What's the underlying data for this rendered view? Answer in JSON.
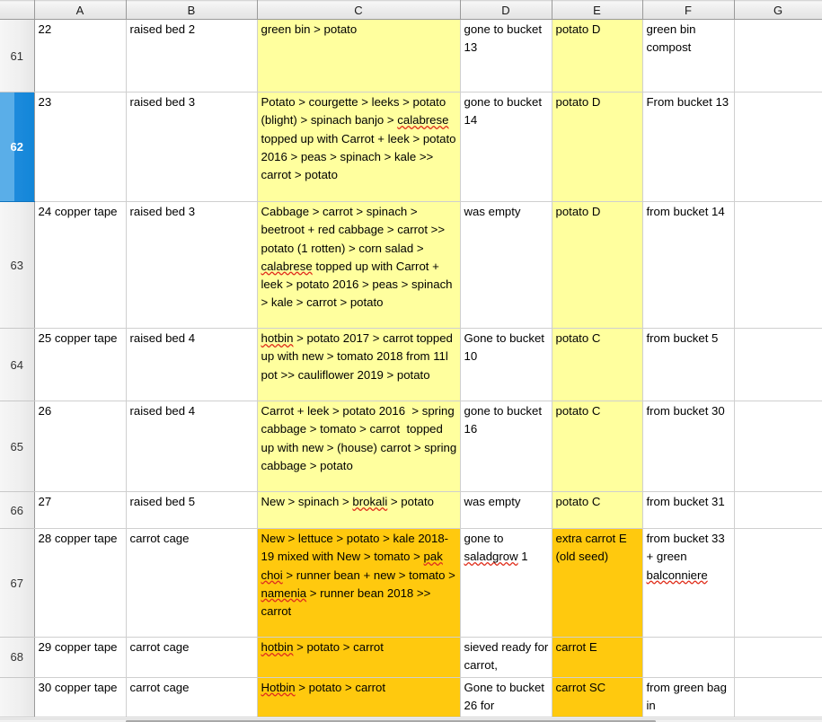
{
  "grid": {
    "column_headers": [
      "A",
      "B",
      "C",
      "D",
      "E",
      "F",
      "G"
    ],
    "corner_label": "",
    "selected_row": "62"
  },
  "rows": [
    {
      "header": "61",
      "selected": false,
      "height": 81,
      "cells": [
        {
          "col": "A",
          "text": "22",
          "fill": "none"
        },
        {
          "col": "B",
          "text": "raised bed 2",
          "fill": "none"
        },
        {
          "col": "C",
          "text": "green bin > potato",
          "fill": "yellow"
        },
        {
          "col": "D",
          "text": "gone to bucket 13",
          "fill": "none"
        },
        {
          "col": "E",
          "text": "potato D",
          "fill": "yellow"
        },
        {
          "col": "F",
          "text": "green bin compost",
          "fill": "none"
        },
        {
          "col": "G",
          "text": "",
          "fill": "none"
        }
      ]
    },
    {
      "header": "62",
      "selected": true,
      "height": 122,
      "cells": [
        {
          "col": "A",
          "text": "23",
          "fill": "none"
        },
        {
          "col": "B",
          "text": "raised bed 3",
          "fill": "none"
        },
        {
          "col": "C",
          "text": "Potato > courgette > leeks > potato (blight) > spinach banjo > calabrese topped up with Carrot + leek > potato 2016 > peas > spinach > kale >> carrot > potato",
          "fill": "yellow",
          "misspelled": [
            "calabrese"
          ]
        },
        {
          "col": "D",
          "text": "gone to bucket 14",
          "fill": "none"
        },
        {
          "col": "E",
          "text": "potato D",
          "fill": "yellow"
        },
        {
          "col": "F",
          "text": "From bucket 13",
          "fill": "none"
        },
        {
          "col": "G",
          "text": "",
          "fill": "none"
        }
      ]
    },
    {
      "header": "63",
      "selected": false,
      "height": 141,
      "cells": [
        {
          "col": "A",
          "text": "24 copper tape",
          "fill": "none"
        },
        {
          "col": "B",
          "text": "raised bed 3",
          "fill": "none"
        },
        {
          "col": "C",
          "text": "Cabbage > carrot > spinach > beetroot + red cabbage > carrot >> potato (1 rotten) > corn salad > calabrese topped up with Carrot + leek > potato 2016 > peas > spinach > kale > carrot > potato",
          "fill": "yellow",
          "misspelled": [
            "calabrese"
          ]
        },
        {
          "col": "D",
          "text": "was empty",
          "fill": "none"
        },
        {
          "col": "E",
          "text": "potato D",
          "fill": "yellow"
        },
        {
          "col": "F",
          "text": "from bucket 14",
          "fill": "none"
        },
        {
          "col": "G",
          "text": "",
          "fill": "none"
        }
      ]
    },
    {
      "header": "64",
      "selected": false,
      "height": 81,
      "cells": [
        {
          "col": "A",
          "text": "25 copper tape",
          "fill": "none"
        },
        {
          "col": "B",
          "text": "raised bed 4",
          "fill": "none"
        },
        {
          "col": "C",
          "text": "hotbin > potato 2017 > carrot topped up with new > tomato 2018 from 11l pot >> cauliflower 2019 > potato",
          "fill": "yellow",
          "misspelled": [
            "hotbin"
          ]
        },
        {
          "col": "D",
          "text": "Gone to bucket 10",
          "fill": "none"
        },
        {
          "col": "E",
          "text": "potato C",
          "fill": "yellow"
        },
        {
          "col": "F",
          "text": "from bucket 5",
          "fill": "none"
        },
        {
          "col": "G",
          "text": "",
          "fill": "none"
        }
      ]
    },
    {
      "header": "65",
      "selected": false,
      "height": 101,
      "cells": [
        {
          "col": "A",
          "text": "26",
          "fill": "none"
        },
        {
          "col": "B",
          "text": "raised bed 4",
          "fill": "none"
        },
        {
          "col": "C",
          "text": "Carrot + leek > potato 2016  > spring cabbage > tomato > carrot  topped up with new > (house) carrot > spring cabbage > potato",
          "fill": "yellow"
        },
        {
          "col": "D",
          "text": "gone to bucket 16",
          "fill": "none"
        },
        {
          "col": "E",
          "text": "potato C",
          "fill": "yellow"
        },
        {
          "col": "F",
          "text": "from bucket 30",
          "fill": "none"
        },
        {
          "col": "G",
          "text": "",
          "fill": "none"
        }
      ]
    },
    {
      "header": "66",
      "selected": false,
      "height": 41,
      "cells": [
        {
          "col": "A",
          "text": "27",
          "fill": "none"
        },
        {
          "col": "B",
          "text": "raised bed 5",
          "fill": "none"
        },
        {
          "col": "C",
          "text": "New > spinach > brokali > potato",
          "fill": "yellow",
          "misspelled": [
            "brokali"
          ]
        },
        {
          "col": "D",
          "text": "was empty",
          "fill": "none"
        },
        {
          "col": "E",
          "text": "potato C",
          "fill": "yellow"
        },
        {
          "col": "F",
          "text": "from bucket 31",
          "fill": "none"
        },
        {
          "col": "G",
          "text": "",
          "fill": "none"
        }
      ]
    },
    {
      "header": "67",
      "selected": false,
      "height": 121,
      "cells": [
        {
          "col": "A",
          "text": "28 copper tape",
          "fill": "none"
        },
        {
          "col": "B",
          "text": "carrot cage",
          "fill": "none"
        },
        {
          "col": "C",
          "text": "New > lettuce > potato > kale 2018-19 mixed with New > tomato > pak choi > runner bean + new > tomato > namenia > runner bean 2018 >> carrot",
          "fill": "orange",
          "misspelled": [
            "pak",
            "choi",
            "namenia"
          ]
        },
        {
          "col": "D",
          "text": "gone to saladgrow 1",
          "fill": "none",
          "misspelled": [
            "saladgrow"
          ]
        },
        {
          "col": "E",
          "text": "extra carrot E (old seed)",
          "fill": "orange"
        },
        {
          "col": "F",
          "text": "from bucket 33 + green balconniere",
          "fill": "none",
          "misspelled": [
            "balconniere"
          ]
        },
        {
          "col": "G",
          "text": "",
          "fill": "none"
        }
      ]
    },
    {
      "header": "68",
      "selected": false,
      "height": 41,
      "cells": [
        {
          "col": "A",
          "text": "29 copper tape",
          "fill": "none"
        },
        {
          "col": "B",
          "text": "carrot cage",
          "fill": "none"
        },
        {
          "col": "C",
          "text": "hotbin > potato > carrot",
          "fill": "orange",
          "misspelled": [
            "hotbin"
          ]
        },
        {
          "col": "D",
          "text": "sieved ready for carrot,",
          "fill": "none"
        },
        {
          "col": "E",
          "text": "carrot E",
          "fill": "orange"
        },
        {
          "col": "F",
          "text": "",
          "fill": "none"
        },
        {
          "col": "G",
          "text": "",
          "fill": "none"
        }
      ]
    },
    {
      "header": "",
      "selected": false,
      "height": 41,
      "cells": [
        {
          "col": "A",
          "text": "30 copper tape",
          "fill": "none"
        },
        {
          "col": "B",
          "text": "carrot cage",
          "fill": "none"
        },
        {
          "col": "C",
          "text": "Hotbin > potato > carrot",
          "fill": "orange",
          "misspelled": [
            "Hotbin"
          ]
        },
        {
          "col": "D",
          "text": "Gone to bucket 26 for",
          "fill": "none"
        },
        {
          "col": "E",
          "text": "carrot SC",
          "fill": "orange"
        },
        {
          "col": "F",
          "text": "from green bag in",
          "fill": "none"
        },
        {
          "col": "G",
          "text": "",
          "fill": "none"
        }
      ]
    }
  ],
  "colors": {
    "fill_yellow": "#ffff9e",
    "fill_orange": "#ffc90e",
    "selection_blue": "#1286d8",
    "selection_blue_light": "#5aaee8",
    "gridline": "#cfcfcf",
    "header_border": "#9a9a9a"
  },
  "scrollbar": {
    "orientation": "horizontal"
  }
}
